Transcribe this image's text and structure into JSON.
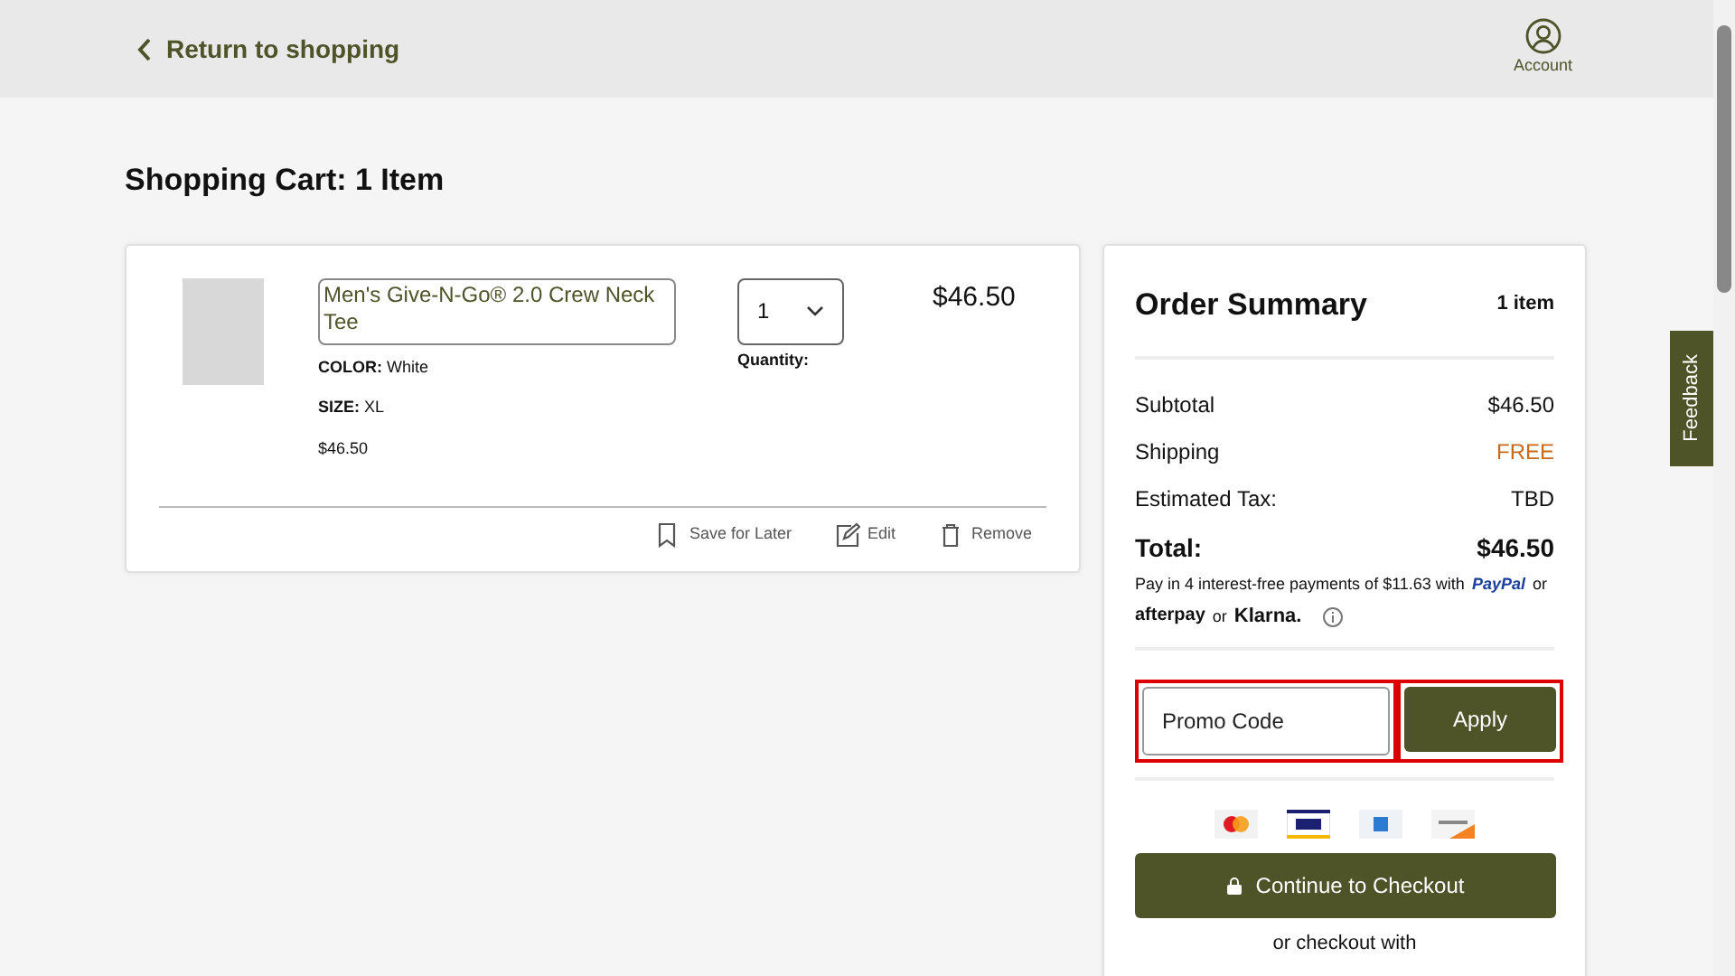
{
  "header": {
    "back_link": "Return to shopping",
    "account": "Account"
  },
  "page_title": "Shopping Cart: 1 Item",
  "cart_items": [
    {
      "name": "Men's Give-N-Go® 2.0 Crew Neck Tee",
      "color_label": "COLOR:",
      "color_value": "White",
      "size_label": "SIZE:",
      "size": "XL",
      "unit_price": "$46.50",
      "quantity": "1",
      "quantity_label": "Quantity:",
      "price": "$46.50",
      "actions": [
        {
          "kind": "save",
          "label": "Save for Later"
        },
        {
          "kind": "edit",
          "label": "Edit"
        },
        {
          "kind": "remove",
          "label": "Remove"
        }
      ]
    }
  ],
  "order_summary": {
    "title": "Order Summary",
    "item_count": "1 item",
    "lines": [
      {
        "label": "Subtotal",
        "value": "$46.50",
        "kind": "plain"
      },
      {
        "label": "Shipping",
        "value": "FREE",
        "kind": "free"
      },
      {
        "label": "Estimated Tax:",
        "value": "TBD",
        "kind": "plain"
      }
    ],
    "total_label": "Total:",
    "total": "$46.50",
    "installments": {
      "text": "Pay in 4 interest-free payments of $11.63 with",
      "paypal": "PayPal",
      "or_1": "or",
      "afterpay": "afterpay",
      "or_2": "or",
      "klarna": "Klarna."
    },
    "promo": {
      "placeholder": "Promo Code",
      "button": "Apply"
    },
    "checkout_button": "Continue to Checkout",
    "alt_checkout": "or checkout with"
  },
  "feedback_tab": "Feedback"
}
